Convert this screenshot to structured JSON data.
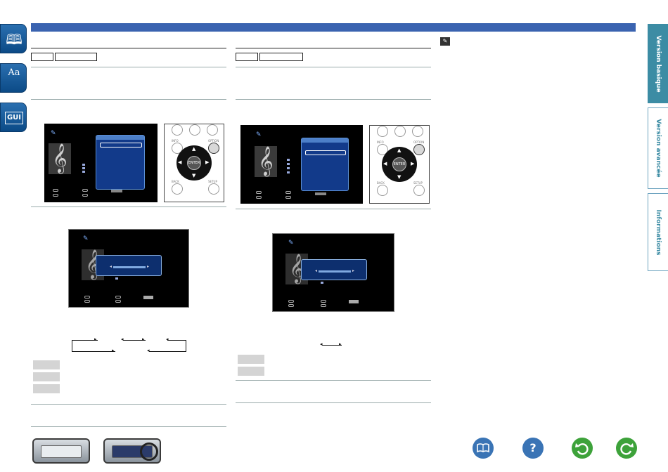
{
  "left_tabs": [
    {
      "name": "contents-tab",
      "glyph": "📖"
    },
    {
      "name": "glossary-tab",
      "glyph": "Aa"
    },
    {
      "name": "gui-tab",
      "glyph": "GUI"
    }
  ],
  "right_tabs": [
    {
      "label": "Version basique"
    },
    {
      "label": "Version avancée"
    },
    {
      "label": "Informations"
    }
  ],
  "bottom_nav": {
    "icons": [
      "book-icon",
      "help-icon",
      "back-icon",
      "forward-icon"
    ],
    "colors": {
      "book": "#3a74b5",
      "help": "#3a74b5",
      "back": "#3da23a",
      "forward": "#3da23a"
    }
  },
  "remote": {
    "enter_label": "ENTER",
    "option_label": "OPTION",
    "info_label": "INFO",
    "back_label": "BACK",
    "setup_label": "SETUP"
  },
  "accent_colors": {
    "top_bar": "#3a63b0",
    "right_tab": "#3c8ca4"
  }
}
